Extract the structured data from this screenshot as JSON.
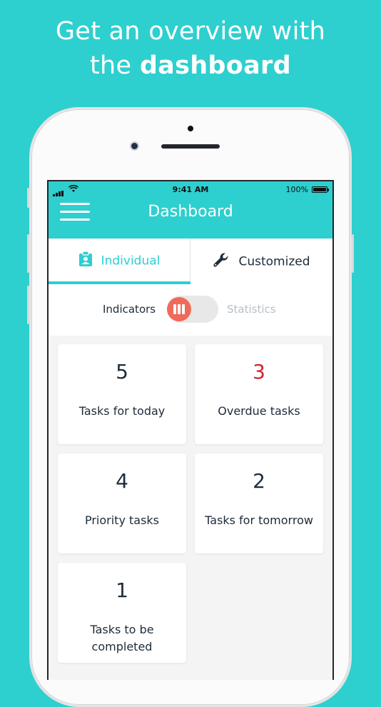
{
  "promo": {
    "line1": "Get an overview with",
    "line2_prefix": "the",
    "line2_bold": "dashboard"
  },
  "status_bar": {
    "time": "9:41 AM",
    "battery": "100%"
  },
  "header": {
    "title": "Dashboard"
  },
  "tabs": [
    {
      "label": "Individual",
      "icon": "badge-icon",
      "selected": true
    },
    {
      "label": "Customized",
      "icon": "wrench-icon",
      "selected": false
    }
  ],
  "toggle": {
    "left_label": "Indicators",
    "right_label": "Statistics",
    "selected": "Indicators"
  },
  "cards": [
    {
      "value": "5",
      "label": "Tasks for today"
    },
    {
      "value": "3",
      "label": "Overdue tasks"
    },
    {
      "value": "4",
      "label": "Priority tasks"
    },
    {
      "value": "2",
      "label": "Tasks for tomorrow"
    },
    {
      "value": "1",
      "label": "Tasks to be completed"
    }
  ],
  "colors": {
    "accent": "#2ecfcf",
    "alert": "#d0262d",
    "toggle_knob": "#f06a5a",
    "text": "#1d2b3a"
  }
}
